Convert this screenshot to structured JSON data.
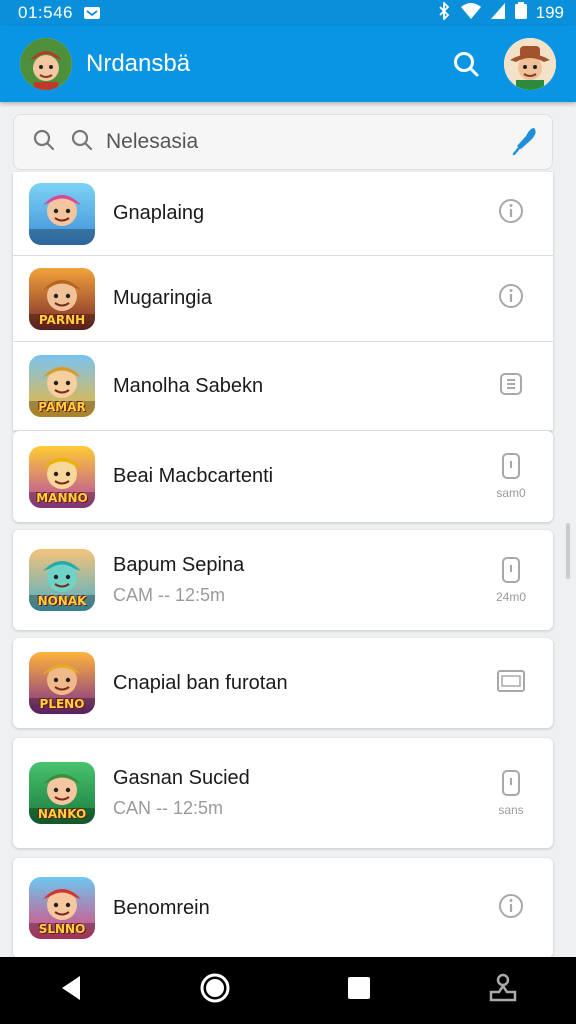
{
  "status_bar": {
    "time": "01:546",
    "battery": "199"
  },
  "app_bar": {
    "title": "Nrdansbä"
  },
  "search": {
    "placeholder": "Nelesasia"
  },
  "items": [
    {
      "title": "Gnaplaing",
      "subtitle": "",
      "caption": "",
      "trail_icon": "info-icon",
      "icon_label": "",
      "icon_colors": [
        "#7dd3f5",
        "#3e8ed8"
      ]
    },
    {
      "title": "Mugaringia",
      "subtitle": "",
      "caption": "",
      "trail_icon": "info-icon",
      "icon_label": "PARNH",
      "icon_colors": [
        "#f2a23a",
        "#7a2b2b"
      ]
    },
    {
      "title": "Manolha Sabekn",
      "subtitle": "",
      "caption": "",
      "trail_icon": "grid-icon",
      "icon_label": "PAMAR",
      "icon_colors": [
        "#79c3ef",
        "#f2b632"
      ]
    },
    {
      "title": "Beai Macbcartenti",
      "subtitle": "",
      "caption": "sam0",
      "trail_icon": "phone-icon",
      "icon_label": "MANNO",
      "icon_colors": [
        "#ffcc33",
        "#b347a8"
      ]
    },
    {
      "title": "Bapum Sepina",
      "subtitle": "CAM -- 12:5m",
      "caption": "24m0",
      "trail_icon": "phone-icon",
      "icon_label": "NONAK",
      "icon_colors": [
        "#f4c27a",
        "#4cb0c6"
      ]
    },
    {
      "title": "Cnapial ban furotan",
      "subtitle": "",
      "caption": "",
      "trail_icon": "tablet-icon",
      "icon_label": "PLENO",
      "icon_colors": [
        "#ffb33c",
        "#7b2e8c"
      ]
    },
    {
      "title": "Gasnan Sucied",
      "subtitle": "CAN -- 12:5m",
      "caption": "sans",
      "trail_icon": "phone-icon",
      "icon_label": "NANKO",
      "icon_colors": [
        "#49c36f",
        "#1a7a3c"
      ]
    },
    {
      "title": "Benomrein",
      "subtitle": "",
      "caption": "",
      "trail_icon": "info-icon",
      "icon_label": "SLNNO",
      "icon_colors": [
        "#6cc8f0",
        "#e2447a"
      ]
    }
  ],
  "colors": {
    "accent": "#0a95e4",
    "status": "#0a8fdb"
  }
}
